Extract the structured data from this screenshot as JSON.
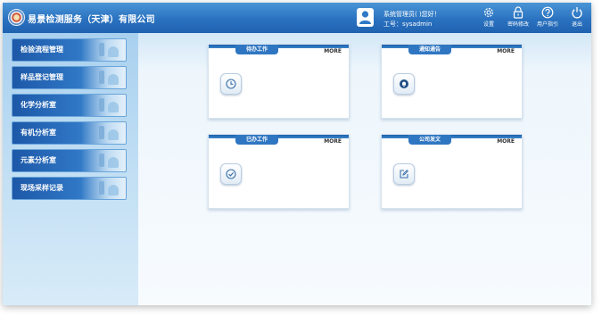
{
  "header": {
    "app_title": "易景检测服务（天津）有限公司",
    "user_greeting": "系统管理员(  )您好！",
    "work_id": "工号：sysadmin",
    "buttons": [
      {
        "label": "设置",
        "icon": "gear-icon"
      },
      {
        "label": "密码修改",
        "icon": "lock-icon"
      },
      {
        "label": "用户指引",
        "icon": "question-icon"
      },
      {
        "label": "退出",
        "icon": "power-icon"
      }
    ]
  },
  "sidebar": {
    "items": [
      {
        "label": "检验流程管理"
      },
      {
        "label": "样品登记管理"
      },
      {
        "label": "化学分析室"
      },
      {
        "label": "有机分析室"
      },
      {
        "label": "元素分析室"
      },
      {
        "label": "现场采样记录"
      }
    ]
  },
  "cards": [
    {
      "title": "待办工作",
      "more": "MORE",
      "icon": "clock-icon"
    },
    {
      "title": "通知通告",
      "more": "MORE",
      "icon": "bell-icon"
    },
    {
      "title": "已办工作",
      "more": "MORE",
      "icon": "check-icon"
    },
    {
      "title": "公司发文",
      "more": "MORE",
      "icon": "edit-icon"
    }
  ],
  "colors": {
    "header": "#2a72c0",
    "sidebar": "#bcdcf3",
    "nav_item": "#2e76c4",
    "card_tab": "#2f76c2"
  }
}
